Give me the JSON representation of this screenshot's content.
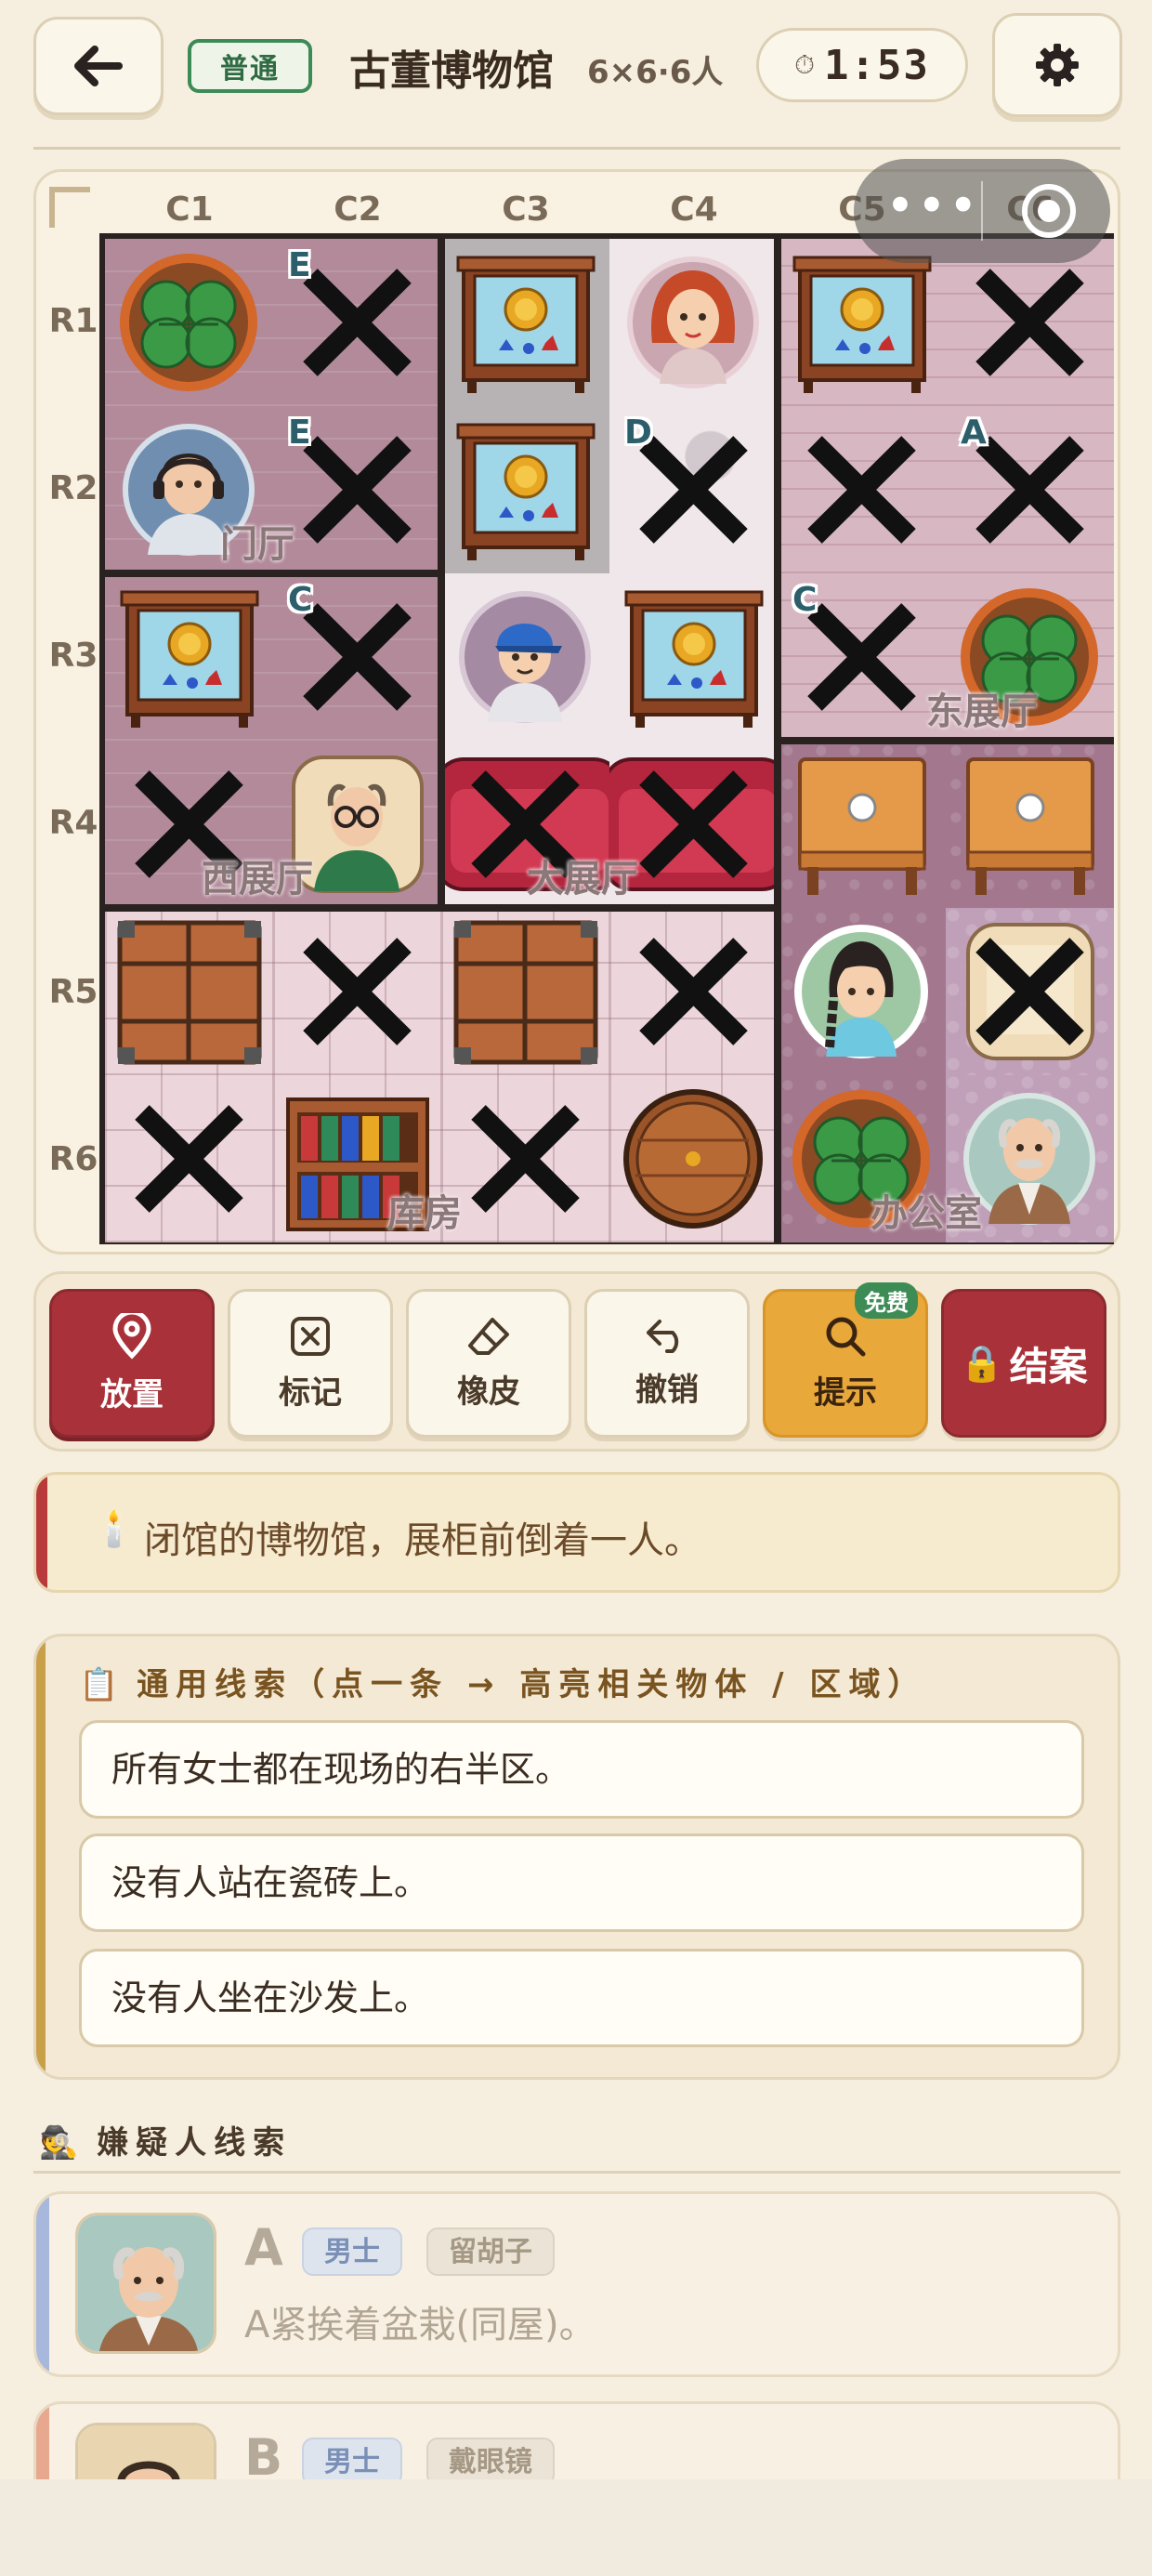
{
  "header": {
    "difficulty": "普通",
    "title": "古董博物馆",
    "size_info": "6×6·6人",
    "timer": "1:53"
  },
  "board": {
    "col_labels": [
      "C1",
      "C2",
      "C3",
      "C4",
      "C5",
      "C6"
    ],
    "row_labels": [
      "R1",
      "R2",
      "R3",
      "R4",
      "R5",
      "R6"
    ],
    "room_labels": [
      "门厅",
      "东展厅",
      "西展厅",
      "大展厅",
      "库房",
      "办公室"
    ],
    "cell_letters": {
      "r1c2": "E",
      "r2c2": "E",
      "r2c4": "D",
      "r2c6": "A",
      "r3c2": "C",
      "r3c5": "C"
    },
    "cells": [
      [
        "plant",
        "x",
        "cabinet",
        "woman-red-hair",
        "cabinet",
        "x"
      ],
      [
        "man-headset",
        "x",
        "cabinet",
        "x",
        "x",
        "x"
      ],
      [
        "cabinet",
        "x",
        "boy-blue-cap",
        "cabinet",
        "x",
        "plant"
      ],
      [
        "x",
        "man-glasses-armchair",
        "sofa-x",
        "sofa-x",
        "table",
        "table"
      ],
      [
        "crate",
        "x",
        "crate",
        "x",
        "woman-braid",
        "armchair-x"
      ],
      [
        "x",
        "bookshelf",
        "x",
        "barrel",
        "plant",
        "old-man-mustache"
      ]
    ]
  },
  "toolbar": {
    "place": "放置",
    "mark": "标记",
    "eraser": "橡皮",
    "undo": "撤销",
    "hint": "提示",
    "hint_badge": "免费",
    "solve": "结案"
  },
  "narrative": "闭馆的博物馆，展柜前倒着一人。",
  "general_clues": {
    "title": "通用线索（点一条 → 高亮相关物体 / 区域）",
    "items": [
      "所有女士都在现场的右半区。",
      "没有人站在瓷砖上。",
      "没有人坐在沙发上。"
    ]
  },
  "suspect_clues": {
    "title": "嫌疑人线索",
    "suspects": [
      {
        "letter": "A",
        "gender": "男士",
        "trait": "留胡子",
        "desc": "A紧挨着盆栽(同屋)。",
        "stripe": "#a8b8dc"
      },
      {
        "letter": "B",
        "gender": "男士",
        "trait": "戴眼镜",
        "desc": "",
        "stripe": "#e8a890"
      }
    ]
  },
  "colors": {
    "accent_red": "#a9323a",
    "hint_gold": "#e9a83a",
    "badge_green": "#3c8a56"
  }
}
